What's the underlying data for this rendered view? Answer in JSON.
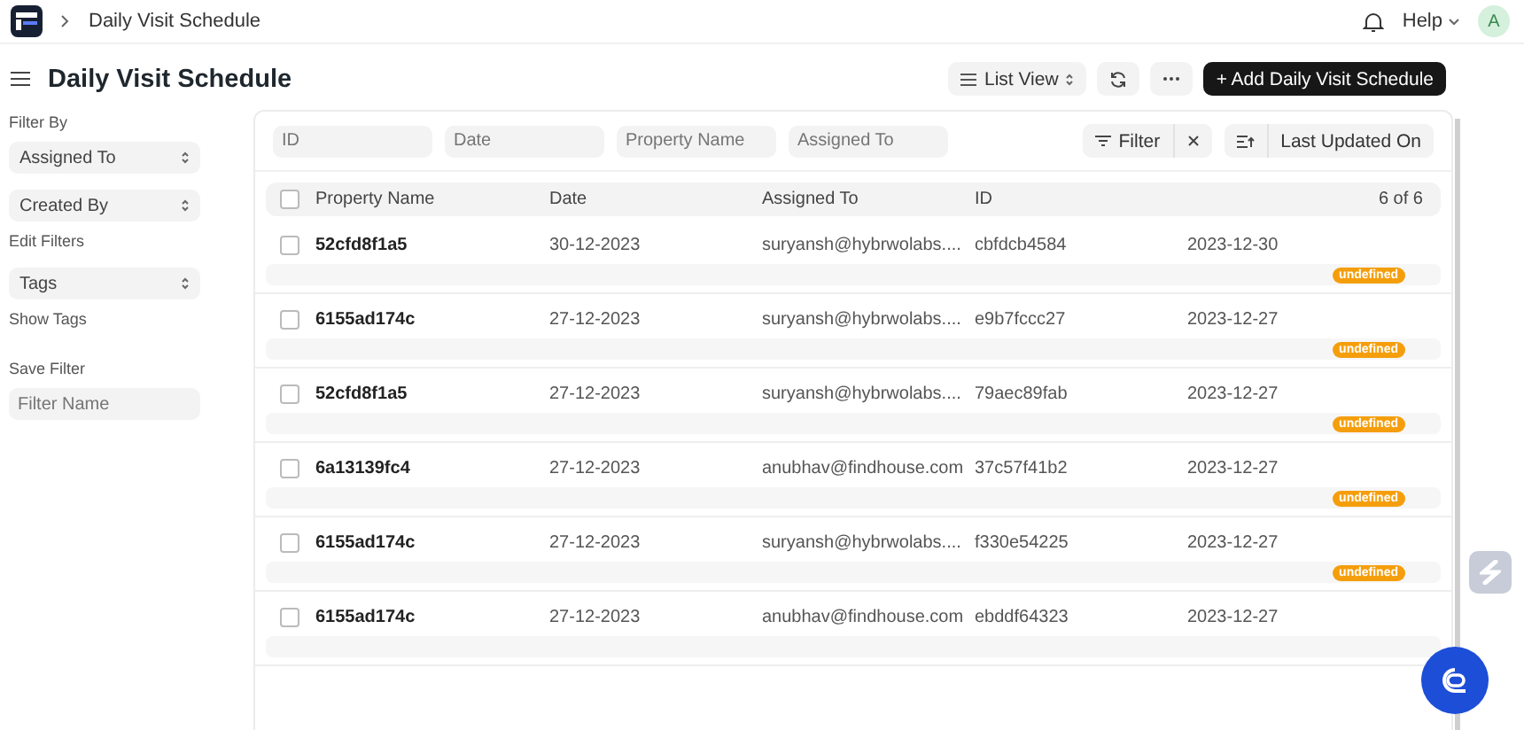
{
  "navbar": {
    "breadcrumb": "Daily Visit Schedule",
    "help": "Help",
    "avatar": "A"
  },
  "page": {
    "title": "Daily Visit Schedule",
    "view_switch": "List View",
    "add_button": "+ Add Daily Visit Schedule"
  },
  "sidebar": {
    "filter_by_label": "Filter By",
    "filter_selects": [
      "Assigned To",
      "Created By"
    ],
    "edit_filters": "Edit Filters",
    "tags_select": "Tags",
    "show_tags": "Show Tags",
    "save_filter_label": "Save Filter",
    "filter_name": {
      "placeholder": "Filter Name"
    }
  },
  "filters": {
    "fields": [
      {
        "placeholder": "ID"
      },
      {
        "placeholder": "Date"
      },
      {
        "placeholder": "Property Name"
      },
      {
        "placeholder": "Assigned To"
      }
    ],
    "filter_button": "Filter",
    "sort_button": "Last Updated On"
  },
  "table": {
    "columns": [
      "Property Name",
      "Date",
      "Assigned To",
      "ID"
    ],
    "count": "6 of 6",
    "select_all_checked": false,
    "rows": [
      {
        "property_name": "52cfd8f1a5",
        "date": "30-12-2023",
        "assigned_to": "suryansh@hybrwolabs....",
        "id": "cbfdcb4584",
        "column_5": "2023-12-30",
        "tag": "undefined",
        "selected": false
      },
      {
        "property_name": "6155ad174c",
        "date": "27-12-2023",
        "assigned_to": "suryansh@hybrwolabs....",
        "id": "e9b7fccc27",
        "column_5": "2023-12-27",
        "tag": "undefined",
        "selected": false
      },
      {
        "property_name": "52cfd8f1a5",
        "date": "27-12-2023",
        "assigned_to": "suryansh@hybrwolabs....",
        "id": "79aec89fab",
        "column_5": "2023-12-27",
        "tag": "undefined",
        "selected": false
      },
      {
        "property_name": "6a13139fc4",
        "date": "27-12-2023",
        "assigned_to": "anubhav@findhouse.com",
        "id": "37c57f41b2",
        "column_5": "2023-12-27",
        "tag": "undefined",
        "selected": false
      },
      {
        "property_name": "6155ad174c",
        "date": "27-12-2023",
        "assigned_to": "suryansh@hybrwolabs....",
        "id": "f330e54225",
        "column_5": "2023-12-27",
        "tag": "undefined",
        "selected": false
      },
      {
        "property_name": "6155ad174c",
        "date": "27-12-2023",
        "assigned_to": "anubhav@findhouse.com",
        "id": "ebddf64323",
        "column_5": "2023-12-27",
        "selected": false
      }
    ]
  }
}
